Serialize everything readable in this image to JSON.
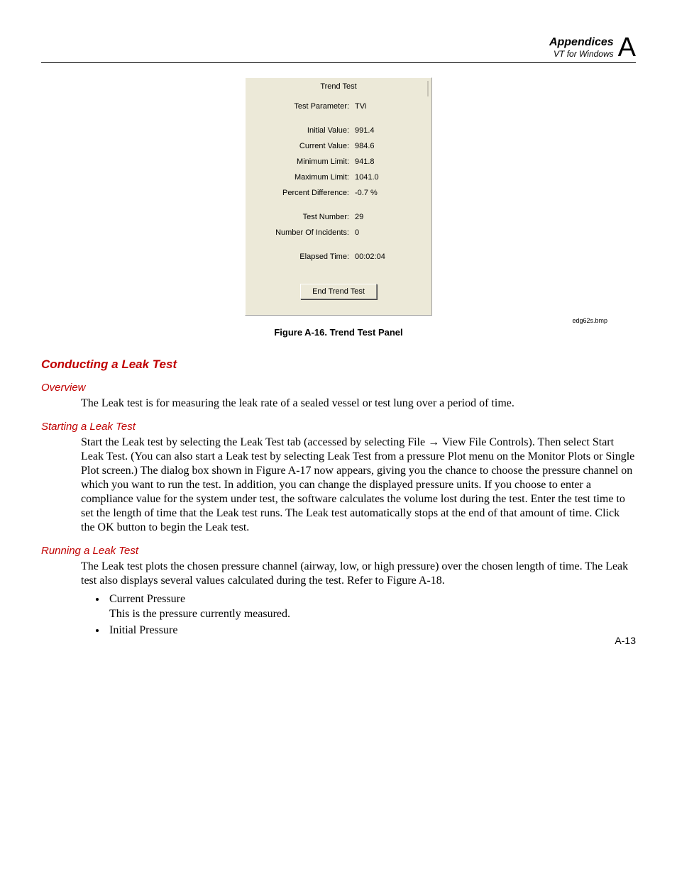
{
  "header": {
    "title": "Appendices",
    "subtitle": "VT for Windows",
    "letter": "A"
  },
  "panel": {
    "title": "Trend Test",
    "rows": {
      "testParameter": {
        "label": "Test Parameter:",
        "value": "TVi"
      },
      "initialValue": {
        "label": "Initial Value:",
        "value": "991.4"
      },
      "currentValue": {
        "label": "Current Value:",
        "value": "984.6"
      },
      "minimumLimit": {
        "label": "Minimum Limit:",
        "value": "941.8"
      },
      "maximumLimit": {
        "label": "Maximum Limit:",
        "value": "1041.0"
      },
      "percentDifference": {
        "label": "Percent Difference:",
        "value": "-0.7 %"
      },
      "testNumber": {
        "label": "Test Number:",
        "value": "29"
      },
      "numberOfIncidents": {
        "label": "Number Of Incidents:",
        "value": "0"
      },
      "elapsedTime": {
        "label": "Elapsed Time:",
        "value": "00:02:04"
      }
    },
    "button": "End Trend Test"
  },
  "imageMeta": "edg62s.bmp",
  "figureCaption": "Figure A-16. Trend Test Panel",
  "sections": {
    "conducting": "Conducting a Leak Test",
    "overview": {
      "title": "Overview",
      "body": "The Leak test is for measuring the leak rate of a sealed vessel or test lung over a period of time."
    },
    "starting": {
      "title": "Starting a Leak Test",
      "body_a": "Start the Leak test by selecting the Leak Test tab (accessed by selecting File ",
      "body_b": " View File Controls). Then select Start Leak Test. (You can also start a Leak test by selecting Leak Test from a pressure Plot menu on the Monitor Plots or Single Plot screen.) The dialog box shown in Figure A-17 now appears, giving you the chance to choose the pressure channel on which you want to run the test. In addition, you can change the displayed pressure units. If you choose to enter a compliance value for the system under test, the software calculates the volume lost during the test. Enter the test time to set the length of time that the Leak test runs. The Leak test automatically stops at the end of that amount of time. Click the OK button to begin the Leak test.",
      "arrow": "→"
    },
    "running": {
      "title": "Running a Leak Test",
      "body": "The Leak test plots the chosen pressure channel (airway, low, or high pressure) over the chosen length of time. The Leak test also displays several values calculated during the test. Refer to Figure A-18.",
      "bullets": {
        "b1": "Current Pressure",
        "b1sub": "This is the pressure currently measured.",
        "b2": "Initial Pressure"
      }
    }
  },
  "pageNumber": "A-13"
}
